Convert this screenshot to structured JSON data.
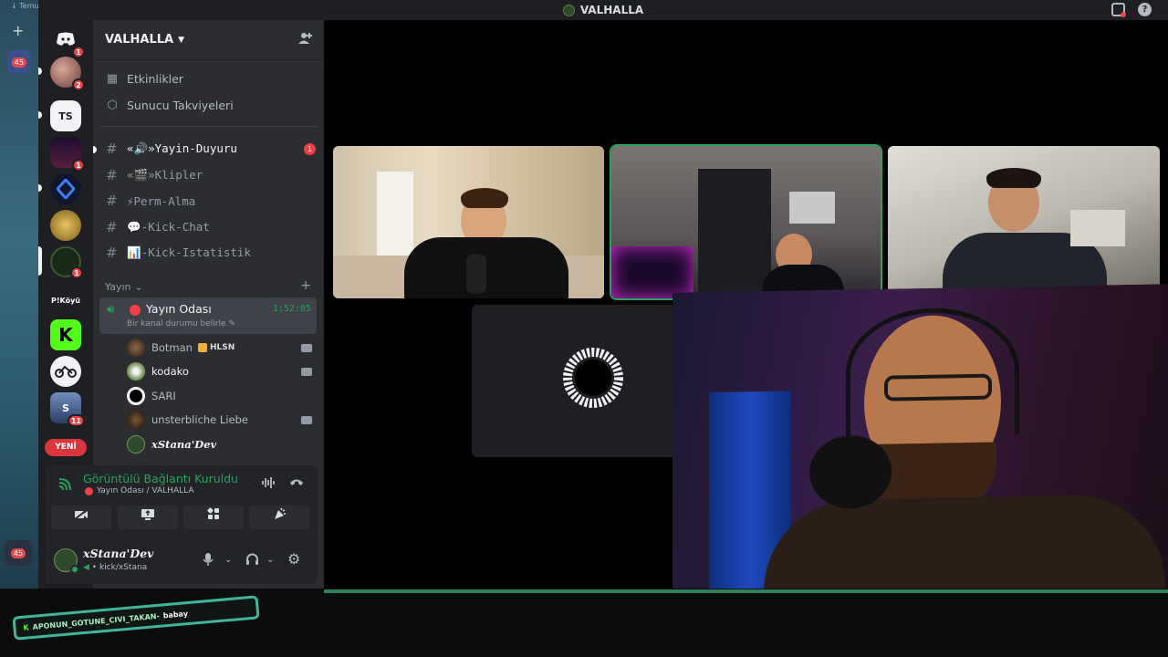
{
  "taskbar": {
    "hint": "↓ Temu",
    "badge": "45",
    "badge2": "45"
  },
  "window": {
    "title": "VALHALLA"
  },
  "server": {
    "name": "VALHALLA"
  },
  "rail": {
    "badges": [
      "1",
      "2",
      "1",
      "1",
      "11"
    ],
    "text_server_1": "TS",
    "text_server_2": "P!Köyü",
    "new_label": "YENİ"
  },
  "nav": {
    "events": "Etkinlikler",
    "boosts": "Sunucu Takviyeleri"
  },
  "channels": [
    {
      "name": "«🔊»Yayin-Duyuru",
      "badge": "1"
    },
    {
      "name": "«🎬»Klipler"
    },
    {
      "name": "⚡Perm-Alma"
    },
    {
      "name": "💬-Kick-Chat"
    },
    {
      "name": "📊-Kick-Istatistik"
    }
  ],
  "category": {
    "name": "Yayın"
  },
  "voice": {
    "channel": "Yayın Odası",
    "elapsed": "1:52:05",
    "status": "Bir kanal durumu belirle",
    "users": [
      {
        "name": "Botman",
        "tag": "HLSN"
      },
      {
        "name": "kodako"
      },
      {
        "name": "SARI"
      },
      {
        "name": "unsterbliche Liebe"
      },
      {
        "name": "xStana'Dev"
      }
    ]
  },
  "rtc": {
    "title": "Görüntülü Bağlantı Kuruldu",
    "subtitle": "Yayın Odası / VALHALLA"
  },
  "user": {
    "name": "xStana'Dev",
    "status": "• kick/xStana"
  },
  "ticker": {
    "prefix": "K",
    "text": "APONUN_GOTUNE_CIVI_TAKAN-",
    "suffix": "babay"
  },
  "colors": {
    "online": "#23a55a",
    "mention": "#f23f43",
    "kick": "#53fc18"
  }
}
